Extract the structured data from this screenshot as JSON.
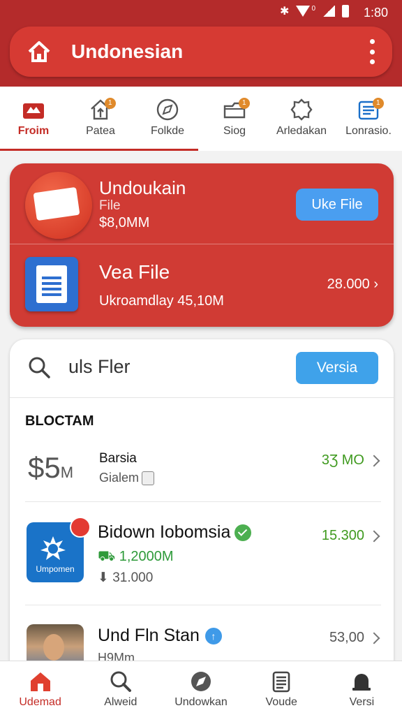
{
  "status": {
    "time": "1:80",
    "network_indicator": "0"
  },
  "appbar": {
    "title": "Undonesian"
  },
  "tabs": [
    {
      "label": "Froim",
      "icon": "home-icon",
      "active": true
    },
    {
      "label": "Patea",
      "icon": "house-up-icon",
      "badge": "1"
    },
    {
      "label": "Folkde",
      "icon": "compass-icon"
    },
    {
      "label": "Siog",
      "icon": "folder-icon",
      "badge": "1"
    },
    {
      "label": "Arledakan",
      "icon": "gear-icon"
    },
    {
      "label": "Lonrasio.",
      "icon": "list-icon",
      "badge": "1"
    }
  ],
  "redcard": {
    "row1": {
      "name": "Undoukain",
      "subtitle": "File",
      "price": "$8,0MM",
      "button": "Uke File"
    },
    "row2": {
      "name": "Vea File",
      "subtitle": "Ukroamdlay 45,10M",
      "count": "28.000"
    }
  },
  "search": {
    "query": "uls Fler",
    "button": "Versia"
  },
  "section_title": "BLOCTAM",
  "items": [
    {
      "icon_text": "$5",
      "icon_suffix": "M",
      "name": "Barsia",
      "sub": "Gialem",
      "value": "3Ʒ MO"
    },
    {
      "icon_label": "Umpomen",
      "name": "Bidown Iobomsia",
      "gain": "1,2000M",
      "downloads": "31.000",
      "value": "15.300"
    },
    {
      "name": "Und Fln Stan",
      "sub": "H9Mm",
      "value": "53,00"
    }
  ],
  "bottomnav": [
    {
      "label": "Udemad",
      "icon": "home-icon",
      "active": true
    },
    {
      "label": "Alweid",
      "icon": "search-icon"
    },
    {
      "label": "Undowkan",
      "icon": "compass-icon"
    },
    {
      "label": "Voude",
      "icon": "clipboard-icon"
    },
    {
      "label": "Versi",
      "icon": "bell-icon"
    }
  ],
  "colors": {
    "brand_red": "#d03b34",
    "accent_blue": "#3fa2ea",
    "green": "#3f9a1f"
  }
}
